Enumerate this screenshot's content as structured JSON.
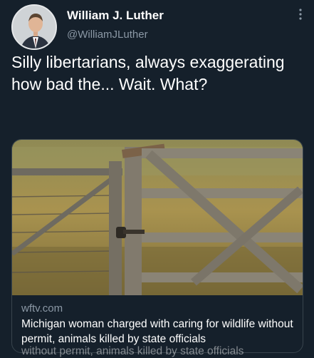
{
  "tweet": {
    "author_name": "William J. Luther",
    "author_handle": "@WilliamJLuther",
    "text": "Silly libertarians, always exaggerating how bad the... Wait. What?"
  },
  "card": {
    "domain": "wftv.com",
    "title": "Michigan woman charged with caring for wildlife without permit, animals killed by state officials",
    "ghost_text": "without permit, animals killed by state officials"
  },
  "icons": {
    "more": "more-vertical-icon",
    "avatar": "profile-photo"
  },
  "colors": {
    "background": "#15202b",
    "secondary_text": "#8b98a5",
    "primary_text": "#ffffff"
  }
}
